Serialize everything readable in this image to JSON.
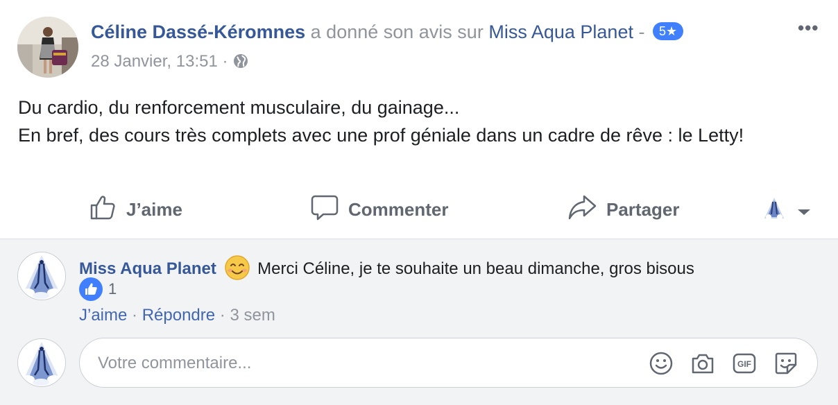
{
  "post": {
    "author": "Céline Dassé-Kéromnes",
    "verb": "a donné son avis sur",
    "page_name": "Miss Aqua Planet",
    "page_separator": "-",
    "rating_badge": "5★",
    "timestamp": "28 Janvier, 13:51",
    "meta_separator": "·",
    "more_label": "•••",
    "review_lines": [
      "Du cardio, du renforcement musculaire, du gainage...",
      "En bref, des cours très complets avec une prof géniale dans un cadre de rêve : le Letty!"
    ]
  },
  "actions": {
    "like": "J’aime",
    "comment": "Commenter",
    "share": "Partager"
  },
  "comment": {
    "author": "Miss Aqua Planet",
    "text": "Merci Céline, je te souhaite un beau dimanche, gros bisous",
    "like_count": "1",
    "like_link": "J’aime",
    "reply_link": "Répondre",
    "separator": "·",
    "time": "3 sem"
  },
  "reply_box": {
    "placeholder": "Votre commentaire..."
  },
  "icons": [
    "globe-icon",
    "thumbs-up-icon",
    "speech-bubble-icon",
    "share-arrow-icon",
    "chevron-down-icon",
    "smiley-icon",
    "camera-icon",
    "gif-icon",
    "sticker-icon"
  ],
  "colors": {
    "link": "#365899",
    "accent": "#4080ff",
    "muted": "#90949c",
    "comment_bg": "#f2f3f5"
  }
}
